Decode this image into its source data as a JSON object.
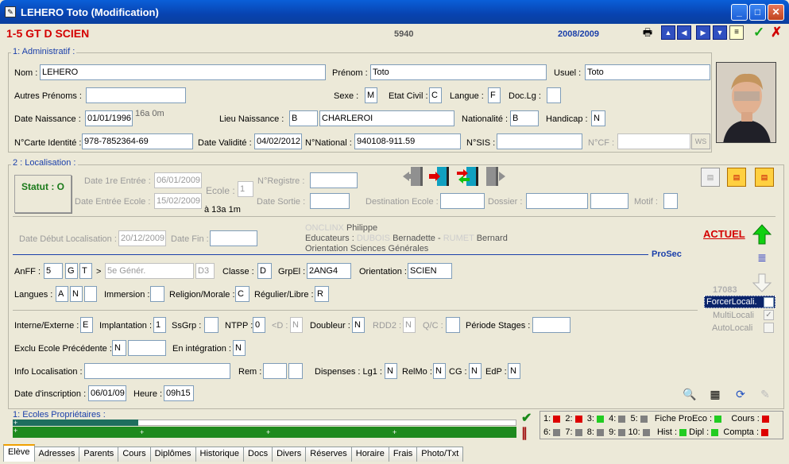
{
  "window": {
    "title": "LEHERO Toto (Modification)",
    "icon": "app-icon"
  },
  "header": {
    "class": "1-5 GT D SCIEN",
    "number": "5940",
    "year": "2008/2009"
  },
  "admin": {
    "section": "1: Administratif :",
    "nom_label": "Nom :",
    "nom": "LEHERO",
    "prenom_label": "Prénom :",
    "prenom": "Toto",
    "usuel_label": "Usuel :",
    "usuel": "Toto",
    "autres_label": "Autres Prénoms :",
    "autres": "",
    "sexe_label": "Sexe :",
    "sexe": "M",
    "etatcivil_label": "Etat Civil :",
    "etatcivil": "C",
    "langue_label": "Langue :",
    "langue": "F",
    "doclg_label": "Doc.Lg :",
    "doclg": "",
    "datenaiss_label": "Date Naissance :",
    "datenaiss": "01/01/1996",
    "age": "16a 0m",
    "lieunaiss_label": "Lieu Naissance :",
    "lieu_code": "B",
    "lieu": "CHARLEROI",
    "nationalite_label": "Nationalité :",
    "nationalite": "B",
    "handicap_label": "Handicap :",
    "handicap": "N",
    "carte_label": "N°Carte Identité :",
    "carte": "978-7852364-69",
    "validite_label": "Date Validité :",
    "validite": "04/02/2012",
    "national_label": "N°National :",
    "national": "940108-911.59",
    "sis_label": "N°SIS :",
    "sis": "",
    "cf_label": "N°CF :",
    "cf": "",
    "ws_label": "WS"
  },
  "loc": {
    "section": "2 : Localisation :",
    "statut": "Statut : O",
    "date1_label": "Date 1re Entrée :",
    "date1": "06/01/2009",
    "dateecole_label": "Date Entrée Ecole :",
    "dateecole": "15/02/2009",
    "dateecole_age": "à 13a 1m",
    "ecole_label": "Ecole :",
    "ecole": "1",
    "registre_label": "N°Registre :",
    "registre": "",
    "sortie_label": "Date Sortie :",
    "sortie": "",
    "destination_label": "Destination Ecole :",
    "destination": "",
    "dossier_label": "Dossier :",
    "dossier": "",
    "dossier2": "",
    "motif_label": "Motif :",
    "motif": "",
    "debut_label": "Date Début Localisation :",
    "debut": "20/12/2009",
    "fin_label": "Date Fin :",
    "fin": "",
    "titulaire_name": "ONCLINX",
    "titulaire": "Philippe",
    "educateurs_label": "Educateurs :",
    "educ1_name": "DUBOIS",
    "educ1": "Bernadette",
    "educ_sep": "-",
    "educ2_name": "RUMET",
    "educ2": "Bernard",
    "orientation_text": "Orientation Sciences Générales",
    "prosec": "ProSec",
    "actuel": "ACTUEL",
    "anff_label": "AnFF :",
    "anff": "5",
    "anff2": "G",
    "anff3": "T",
    "arrow": ">",
    "gener": "5e Génér.",
    "d3": "D3",
    "classe_label": "Classe :",
    "classe": "D",
    "grpel_label": "GrpEl :",
    "grpel": "2ANG4",
    "orientation_label": "Orientation :",
    "orientation": "SCIEN",
    "langues_label": "Langues :",
    "langue1": "A",
    "langue2": "N",
    "langue3": "",
    "immersion_label": "Immersion :",
    "immersion": "",
    "religion_label": "Religion/Morale :",
    "religion": "C",
    "regulier_label": "Régulier/Libre :",
    "regulier": "R",
    "side_num": "17083",
    "forcer_label": "ForcerLocali.",
    "multi_label": "MultiLocali",
    "auto_label": "AutoLocali",
    "interne_label": "Interne/Externe :",
    "interne": "E",
    "implantation_label": "Implantation :",
    "implantation": "1",
    "ssgrp_label": "SsGrp :",
    "ssgrp": "",
    "ntpp_label": "NTPP :",
    "ntpp": "0",
    "lt_label": "<D :",
    "lt": "N",
    "doubleur_label": "Doubleur :",
    "doubleur": "N",
    "rdd2_label": "RDD2 :",
    "rdd2": "N",
    "qc_label": "Q/C :",
    "qc": "",
    "stages_label": "Période Stages :",
    "stages": "",
    "exclu_label": "Exclu Ecole Précédente :",
    "exclu": "N",
    "exclu2": "",
    "integration_label": "En intégration :",
    "integration": "N",
    "info_label": "Info Localisation :",
    "info": "",
    "rem_label": "Rem :",
    "rem": "",
    "rem2": "",
    "dispenses_label": "Dispenses : Lg1 :",
    "lg1": "N",
    "relmo_label": "RelMo :",
    "relmo": "N",
    "cg_label": "CG :",
    "cg": "N",
    "edp_label": "EdP :",
    "edp": "N",
    "inscription_label": "Date d'inscription :",
    "inscription": "06/01/09",
    "heure_label": "Heure :",
    "heure": "09h15"
  },
  "ecoles": {
    "section": "1: Ecoles Propriétaires :",
    "plus": "+"
  },
  "status": {
    "n1": "1:",
    "n2": "2:",
    "n3": "3:",
    "n4": "4:",
    "n5": "5:",
    "n6": "6:",
    "n7": "7:",
    "n8": "8:",
    "n9": "9:",
    "n10": "10:",
    "ficheproeco": "Fiche ProEco :",
    "cours": "Cours :",
    "hist": "Hist :",
    "dipl": "Dipl :",
    "compta": "Compta :"
  },
  "colors": {
    "red": "#dd0000",
    "green": "#22cc22",
    "grey": "#808080",
    "accent": "#1a3faa"
  },
  "tabs": [
    "Elève",
    "Adresses",
    "Parents",
    "Cours",
    "Diplômes",
    "Historique",
    "Docs",
    "Divers",
    "Réserves",
    "Horaire",
    "Frais",
    "Photo/Txt"
  ]
}
